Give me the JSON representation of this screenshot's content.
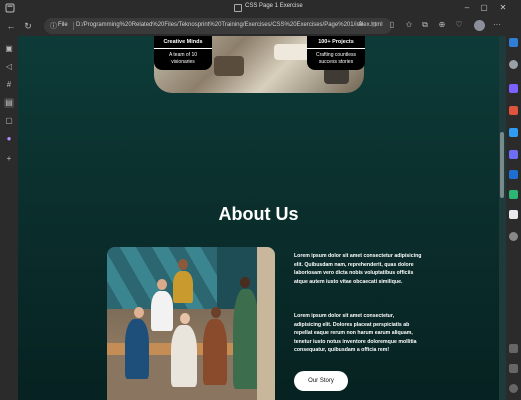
{
  "browser": {
    "window_title": "CSS Page 1 Exercise",
    "address": {
      "scheme_label": "File",
      "url": "D:/Programming%20Related%20Files/Teknosprint%20Training/Exercises/CSS%20Exercises/Page%201/index.html"
    },
    "icons": [
      "back-icon",
      "refresh-icon",
      "info-icon",
      "read-aloud-icon",
      "favorite-icon",
      "split-screen-icon",
      "favorites-icon",
      "collections-icon",
      "extensions-icon",
      "profile-icon",
      "more-icon"
    ]
  },
  "page": {
    "cards": [
      {
        "title": "Creative Minds",
        "text": "A team of 10 visionaries"
      },
      {
        "title": "100+ Projects",
        "text": "Crafting countless success stories"
      }
    ],
    "about": {
      "title": "About Us",
      "paragraph1": "Lorem ipsum dolor sit amet consectetur adipisicing elit. Quibusdam nam, reprehenderit, quas dolore laboriosam vero dicta nobis voluptatibus officiis atque autem iusto vitae obcaecati similique.",
      "paragraph2": "Lorem ipsum dolor sit amet consectetur, adipisicing elit. Dolores placeat perspiciatis ab repellat eaque rerum non harum earum aliquam, tenetur iusto notus inventore doloremque mollitia consequatur, quibusdam a officia rem!",
      "button": "Our Story"
    }
  },
  "colors": {
    "page_bg_top": "#0d3b38",
    "page_bg_bottom": "#062221",
    "card_bg": "#000000",
    "button_bg": "#ffffff"
  }
}
